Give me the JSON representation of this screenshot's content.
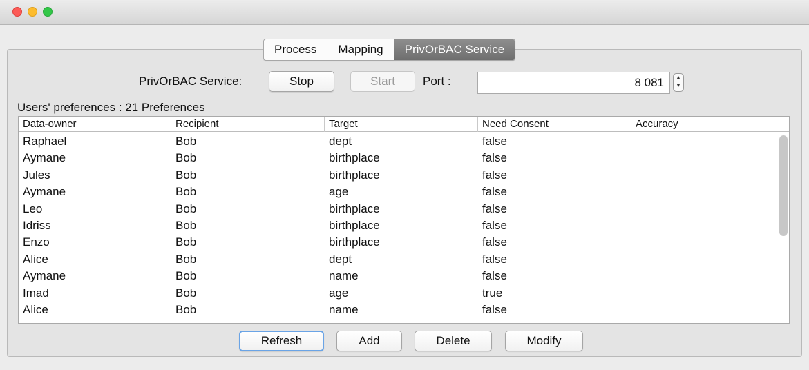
{
  "window": {
    "controls": [
      "close",
      "minimize",
      "zoom"
    ]
  },
  "tabs": [
    {
      "label": "Process",
      "active": false
    },
    {
      "label": "Mapping",
      "active": false
    },
    {
      "label": "PrivOrBAC Service",
      "active": true
    }
  ],
  "service": {
    "label": "PrivOrBAC Service:",
    "stop_label": "Stop",
    "start_label": "Start",
    "port_label": "Port :",
    "port_value": "8 081"
  },
  "preferences": {
    "title": "Users' preferences : 21 Preferences",
    "columns": [
      "Data-owner",
      "Recipient",
      "Target",
      "Need Consent",
      "Accuracy"
    ],
    "rows": [
      [
        "Raphael",
        "Bob",
        "dept",
        "false",
        ""
      ],
      [
        "Aymane",
        "Bob",
        "birthplace",
        "false",
        ""
      ],
      [
        "Jules",
        "Bob",
        "birthplace",
        "false",
        ""
      ],
      [
        "Aymane",
        "Bob",
        "age",
        "false",
        ""
      ],
      [
        "Leo",
        "Bob",
        "birthplace",
        "false",
        ""
      ],
      [
        "Idriss",
        "Bob",
        "birthplace",
        "false",
        ""
      ],
      [
        "Enzo",
        "Bob",
        "birthplace",
        "false",
        ""
      ],
      [
        "Alice",
        "Bob",
        "dept",
        "false",
        ""
      ],
      [
        "Aymane",
        "Bob",
        "name",
        "false",
        ""
      ],
      [
        "Imad",
        "Bob",
        "age",
        "true",
        ""
      ],
      [
        "Alice",
        "Bob",
        "name",
        "false",
        ""
      ]
    ]
  },
  "actions": {
    "refresh_label": "Refresh",
    "add_label": "Add",
    "delete_label": "Delete",
    "modify_label": "Modify"
  }
}
